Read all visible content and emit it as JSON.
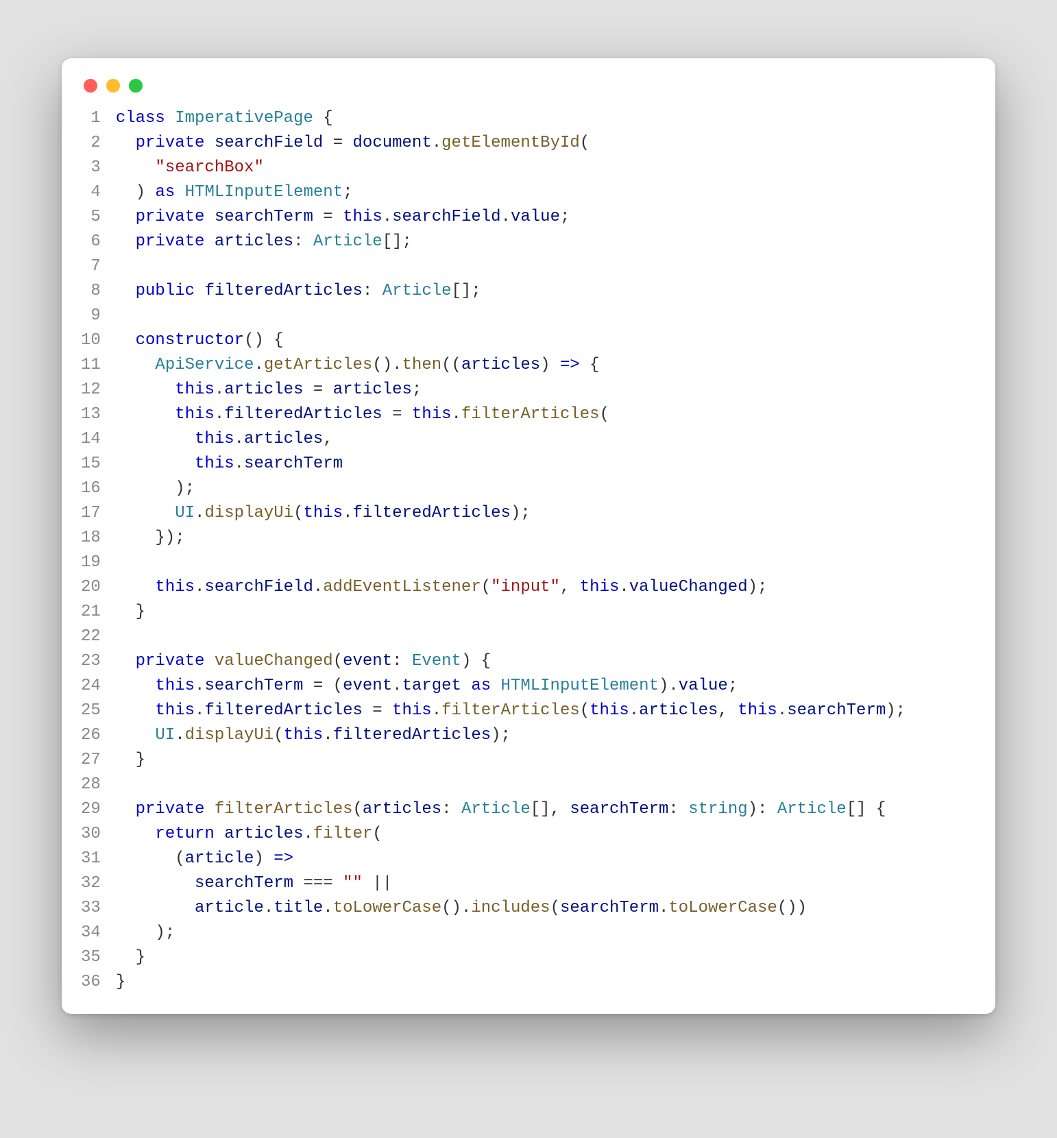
{
  "window": {
    "traffic_lights": [
      "red",
      "yellow",
      "green"
    ]
  },
  "code": {
    "language": "typescript",
    "line_count": 36,
    "lines": [
      {
        "n": 1,
        "indent": 0,
        "tokens": [
          [
            "kw",
            "class"
          ],
          [
            "pun",
            " "
          ],
          [
            "type",
            "ImperativePage"
          ],
          [
            "pun",
            " {"
          ]
        ]
      },
      {
        "n": 2,
        "indent": 1,
        "tokens": [
          [
            "kw",
            "private"
          ],
          [
            "pun",
            " "
          ],
          [
            "var",
            "searchField"
          ],
          [
            "pun",
            " = "
          ],
          [
            "var",
            "document"
          ],
          [
            "pun",
            "."
          ],
          [
            "fn",
            "getElementById"
          ],
          [
            "pun",
            "("
          ]
        ]
      },
      {
        "n": 3,
        "indent": 2,
        "tokens": [
          [
            "str",
            "\"searchBox\""
          ]
        ]
      },
      {
        "n": 4,
        "indent": 1,
        "tokens": [
          [
            "pun",
            ") "
          ],
          [
            "kw",
            "as"
          ],
          [
            "pun",
            " "
          ],
          [
            "type",
            "HTMLInputElement"
          ],
          [
            "pun",
            ";"
          ]
        ]
      },
      {
        "n": 5,
        "indent": 1,
        "tokens": [
          [
            "kw",
            "private"
          ],
          [
            "pun",
            " "
          ],
          [
            "var",
            "searchTerm"
          ],
          [
            "pun",
            " = "
          ],
          [
            "kw",
            "this"
          ],
          [
            "pun",
            "."
          ],
          [
            "var",
            "searchField"
          ],
          [
            "pun",
            "."
          ],
          [
            "var",
            "value"
          ],
          [
            "pun",
            ";"
          ]
        ]
      },
      {
        "n": 6,
        "indent": 1,
        "tokens": [
          [
            "kw",
            "private"
          ],
          [
            "pun",
            " "
          ],
          [
            "var",
            "articles"
          ],
          [
            "pun",
            ": "
          ],
          [
            "type",
            "Article"
          ],
          [
            "pun",
            "[];"
          ]
        ]
      },
      {
        "n": 7,
        "indent": 0,
        "tokens": []
      },
      {
        "n": 8,
        "indent": 1,
        "tokens": [
          [
            "kw",
            "public"
          ],
          [
            "pun",
            " "
          ],
          [
            "var",
            "filteredArticles"
          ],
          [
            "pun",
            ": "
          ],
          [
            "type",
            "Article"
          ],
          [
            "pun",
            "[];"
          ]
        ]
      },
      {
        "n": 9,
        "indent": 0,
        "tokens": []
      },
      {
        "n": 10,
        "indent": 1,
        "tokens": [
          [
            "kw",
            "constructor"
          ],
          [
            "pun",
            "() {"
          ]
        ]
      },
      {
        "n": 11,
        "indent": 2,
        "tokens": [
          [
            "type",
            "ApiService"
          ],
          [
            "pun",
            "."
          ],
          [
            "fn",
            "getArticles"
          ],
          [
            "pun",
            "()."
          ],
          [
            "fn",
            "then"
          ],
          [
            "pun",
            "(("
          ],
          [
            "var",
            "articles"
          ],
          [
            "pun",
            ") "
          ],
          [
            "kw",
            "=>"
          ],
          [
            "pun",
            " {"
          ]
        ]
      },
      {
        "n": 12,
        "indent": 3,
        "tokens": [
          [
            "kw",
            "this"
          ],
          [
            "pun",
            "."
          ],
          [
            "var",
            "articles"
          ],
          [
            "pun",
            " = "
          ],
          [
            "var",
            "articles"
          ],
          [
            "pun",
            ";"
          ]
        ]
      },
      {
        "n": 13,
        "indent": 3,
        "tokens": [
          [
            "kw",
            "this"
          ],
          [
            "pun",
            "."
          ],
          [
            "var",
            "filteredArticles"
          ],
          [
            "pun",
            " = "
          ],
          [
            "kw",
            "this"
          ],
          [
            "pun",
            "."
          ],
          [
            "fn",
            "filterArticles"
          ],
          [
            "pun",
            "("
          ]
        ]
      },
      {
        "n": 14,
        "indent": 4,
        "tokens": [
          [
            "kw",
            "this"
          ],
          [
            "pun",
            "."
          ],
          [
            "var",
            "articles"
          ],
          [
            "pun",
            ","
          ]
        ]
      },
      {
        "n": 15,
        "indent": 4,
        "tokens": [
          [
            "kw",
            "this"
          ],
          [
            "pun",
            "."
          ],
          [
            "var",
            "searchTerm"
          ]
        ]
      },
      {
        "n": 16,
        "indent": 3,
        "tokens": [
          [
            "pun",
            ");"
          ]
        ]
      },
      {
        "n": 17,
        "indent": 3,
        "tokens": [
          [
            "type",
            "UI"
          ],
          [
            "pun",
            "."
          ],
          [
            "fn",
            "displayUi"
          ],
          [
            "pun",
            "("
          ],
          [
            "kw",
            "this"
          ],
          [
            "pun",
            "."
          ],
          [
            "var",
            "filteredArticles"
          ],
          [
            "pun",
            ");"
          ]
        ]
      },
      {
        "n": 18,
        "indent": 2,
        "tokens": [
          [
            "pun",
            "});"
          ]
        ]
      },
      {
        "n": 19,
        "indent": 0,
        "tokens": []
      },
      {
        "n": 20,
        "indent": 2,
        "tokens": [
          [
            "kw",
            "this"
          ],
          [
            "pun",
            "."
          ],
          [
            "var",
            "searchField"
          ],
          [
            "pun",
            "."
          ],
          [
            "fn",
            "addEventListener"
          ],
          [
            "pun",
            "("
          ],
          [
            "str",
            "\"input\""
          ],
          [
            "pun",
            ", "
          ],
          [
            "kw",
            "this"
          ],
          [
            "pun",
            "."
          ],
          [
            "var",
            "valueChanged"
          ],
          [
            "pun",
            ");"
          ]
        ]
      },
      {
        "n": 21,
        "indent": 1,
        "tokens": [
          [
            "pun",
            "}"
          ]
        ]
      },
      {
        "n": 22,
        "indent": 0,
        "tokens": []
      },
      {
        "n": 23,
        "indent": 1,
        "tokens": [
          [
            "kw",
            "private"
          ],
          [
            "pun",
            " "
          ],
          [
            "fn",
            "valueChanged"
          ],
          [
            "pun",
            "("
          ],
          [
            "var",
            "event"
          ],
          [
            "pun",
            ": "
          ],
          [
            "type",
            "Event"
          ],
          [
            "pun",
            ") {"
          ]
        ]
      },
      {
        "n": 24,
        "indent": 2,
        "tokens": [
          [
            "kw",
            "this"
          ],
          [
            "pun",
            "."
          ],
          [
            "var",
            "searchTerm"
          ],
          [
            "pun",
            " = ("
          ],
          [
            "var",
            "event"
          ],
          [
            "pun",
            "."
          ],
          [
            "var",
            "target"
          ],
          [
            "pun",
            " "
          ],
          [
            "kw",
            "as"
          ],
          [
            "pun",
            " "
          ],
          [
            "type",
            "HTMLInputElement"
          ],
          [
            "pun",
            ")."
          ],
          [
            "var",
            "value"
          ],
          [
            "pun",
            ";"
          ]
        ]
      },
      {
        "n": 25,
        "indent": 2,
        "tokens": [
          [
            "kw",
            "this"
          ],
          [
            "pun",
            "."
          ],
          [
            "var",
            "filteredArticles"
          ],
          [
            "pun",
            " = "
          ],
          [
            "kw",
            "this"
          ],
          [
            "pun",
            "."
          ],
          [
            "fn",
            "filterArticles"
          ],
          [
            "pun",
            "("
          ],
          [
            "kw",
            "this"
          ],
          [
            "pun",
            "."
          ],
          [
            "var",
            "articles"
          ],
          [
            "pun",
            ", "
          ],
          [
            "kw",
            "this"
          ],
          [
            "pun",
            "."
          ],
          [
            "var",
            "searchTerm"
          ],
          [
            "pun",
            ");"
          ]
        ]
      },
      {
        "n": 26,
        "indent": 2,
        "tokens": [
          [
            "type",
            "UI"
          ],
          [
            "pun",
            "."
          ],
          [
            "fn",
            "displayUi"
          ],
          [
            "pun",
            "("
          ],
          [
            "kw",
            "this"
          ],
          [
            "pun",
            "."
          ],
          [
            "var",
            "filteredArticles"
          ],
          [
            "pun",
            ");"
          ]
        ]
      },
      {
        "n": 27,
        "indent": 1,
        "tokens": [
          [
            "pun",
            "}"
          ]
        ]
      },
      {
        "n": 28,
        "indent": 0,
        "tokens": []
      },
      {
        "n": 29,
        "indent": 1,
        "tokens": [
          [
            "kw",
            "private"
          ],
          [
            "pun",
            " "
          ],
          [
            "fn",
            "filterArticles"
          ],
          [
            "pun",
            "("
          ],
          [
            "var",
            "articles"
          ],
          [
            "pun",
            ": "
          ],
          [
            "type",
            "Article"
          ],
          [
            "pun",
            "[], "
          ],
          [
            "var",
            "searchTerm"
          ],
          [
            "pun",
            ": "
          ],
          [
            "type",
            "string"
          ],
          [
            "pun",
            "): "
          ],
          [
            "type",
            "Article"
          ],
          [
            "pun",
            "[] {"
          ]
        ]
      },
      {
        "n": 30,
        "indent": 2,
        "tokens": [
          [
            "kw",
            "return"
          ],
          [
            "pun",
            " "
          ],
          [
            "var",
            "articles"
          ],
          [
            "pun",
            "."
          ],
          [
            "fn",
            "filter"
          ],
          [
            "pun",
            "("
          ]
        ]
      },
      {
        "n": 31,
        "indent": 3,
        "tokens": [
          [
            "pun",
            "("
          ],
          [
            "var",
            "article"
          ],
          [
            "pun",
            ") "
          ],
          [
            "kw",
            "=>"
          ]
        ]
      },
      {
        "n": 32,
        "indent": 4,
        "tokens": [
          [
            "var",
            "searchTerm"
          ],
          [
            "pun",
            " === "
          ],
          [
            "str",
            "\"\""
          ],
          [
            "pun",
            " ||"
          ]
        ]
      },
      {
        "n": 33,
        "indent": 4,
        "tokens": [
          [
            "var",
            "article"
          ],
          [
            "pun",
            "."
          ],
          [
            "var",
            "title"
          ],
          [
            "pun",
            "."
          ],
          [
            "fn",
            "toLowerCase"
          ],
          [
            "pun",
            "()."
          ],
          [
            "fn",
            "includes"
          ],
          [
            "pun",
            "("
          ],
          [
            "var",
            "searchTerm"
          ],
          [
            "pun",
            "."
          ],
          [
            "fn",
            "toLowerCase"
          ],
          [
            "pun",
            "())"
          ]
        ]
      },
      {
        "n": 34,
        "indent": 2,
        "tokens": [
          [
            "pun",
            ");"
          ]
        ]
      },
      {
        "n": 35,
        "indent": 1,
        "tokens": [
          [
            "pun",
            "}"
          ]
        ]
      },
      {
        "n": 36,
        "indent": 0,
        "tokens": [
          [
            "pun",
            "}"
          ]
        ]
      }
    ]
  }
}
